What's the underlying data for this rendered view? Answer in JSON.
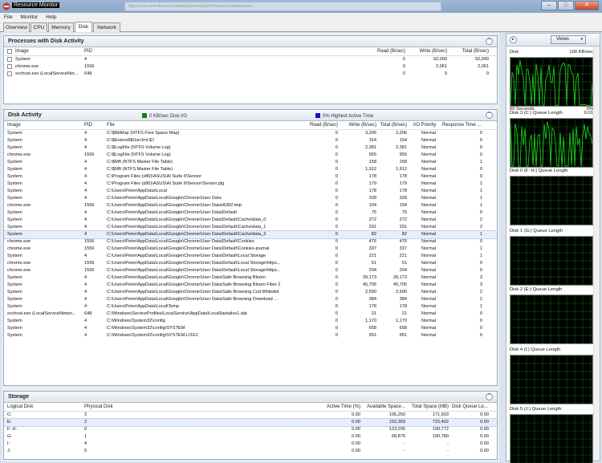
{
  "window": {
    "title": "Resource Monitor",
    "url_text": "http://www.sevenforums.com/attachments/performance-maintenance/...",
    "min": "–",
    "max": "□",
    "close": "✕"
  },
  "menu": [
    "File",
    "Monitor",
    "Help"
  ],
  "tabs": [
    "Overview",
    "CPU",
    "Memory",
    "Disk",
    "Network"
  ],
  "processes": {
    "title": "Processes with Disk Activity",
    "columns": [
      "Image",
      "PID",
      "Read (B/sec)",
      "Write (B/sec)",
      "Total (B/sec)"
    ],
    "rows": [
      [
        "System",
        "4",
        "0",
        "92,000",
        "92,000"
      ],
      [
        "chrome.exe",
        "1556",
        "0",
        "2,061",
        "2,061"
      ],
      [
        "svchost.exe (LocalServiceNet...",
        "648",
        "0",
        "9",
        "9"
      ]
    ]
  },
  "disk_activity": {
    "title": "Disk Activity",
    "legend_io": "0 KB/sec Disk I/O",
    "legend_active": "0% Highest Active Time",
    "io_color": "#1a7a1a",
    "active_color": "#1414c8",
    "columns": [
      "Image",
      "PID",
      "File",
      "Read (B/sec)",
      "Write (B/sec)",
      "Total (B/sec)",
      "I/O Priority",
      "Response Time ..."
    ],
    "rows": [
      [
        "System",
        "4",
        "C:\\$BitMap (NTFS Free Space Map)",
        "0",
        "3,206",
        "3,206",
        "Normal",
        "0"
      ],
      [
        "System",
        "4",
        "C:\\$Extend\\$UsnJrnl:$J",
        "0",
        "154",
        "154",
        "Normal",
        "0"
      ],
      [
        "System",
        "4",
        "C:\\$LogFile (NTFS Volume Log)",
        "0",
        "2,381",
        "2,381",
        "Normal",
        "0"
      ],
      [
        "chrome.exe",
        "1556",
        "C:\\$LogFile (NTFS Volume Log)",
        "0",
        "955",
        "955",
        "Normal",
        "0"
      ],
      [
        "System",
        "4",
        "C:\\$Mft (NTFS Master File Table)",
        "0",
        "158",
        "158",
        "Normal",
        "1"
      ],
      [
        "System",
        "4",
        "C:\\$Mft (NTFS Master File Table)",
        "0",
        "1,912",
        "1,912",
        "Normal",
        "0"
      ],
      [
        "System",
        "4",
        "C:\\Program Files (x86)\\ASUS\\AI Suite II\\Sensor",
        "0",
        "178",
        "178",
        "Normal",
        "0"
      ],
      [
        "System",
        "4",
        "C:\\Program Files (x86)\\ASUS\\AI Suite II\\Sensor\\Sensor.plg",
        "0",
        "179",
        "179",
        "Normal",
        "1"
      ],
      [
        "System",
        "4",
        "C:\\Users\\Peter\\AppData\\Local",
        "0",
        "178",
        "178",
        "Normal",
        "1"
      ],
      [
        "System",
        "4",
        "C:\\Users\\Peter\\AppData\\Local\\Google\\Chrome\\User Data",
        "0",
        "328",
        "328",
        "Normal",
        "1"
      ],
      [
        "chrome.exe",
        "1556",
        "C:\\Users\\Peter\\AppData\\Local\\Google\\Chrome\\User Data\\A392.tmp",
        "0",
        "104",
        "104",
        "Normal",
        "1"
      ],
      [
        "System",
        "4",
        "C:\\Users\\Peter\\AppData\\Local\\Google\\Chrome\\User Data\\Default",
        "0",
        "75",
        "75",
        "Normal",
        "0"
      ],
      [
        "System",
        "4",
        "C:\\Users\\Peter\\AppData\\Local\\Google\\Chrome\\User Data\\Default\\Cache\\data_0",
        "0",
        "272",
        "272",
        "Normal",
        "2"
      ],
      [
        "System",
        "4",
        "C:\\Users\\Peter\\AppData\\Local\\Google\\Chrome\\User Data\\Default\\Cache\\data_1",
        "0",
        "291",
        "291",
        "Normal",
        "2"
      ],
      [
        "System",
        "4",
        "C:\\Users\\Peter\\AppData\\Local\\Google\\Chrome\\User Data\\Default\\Cache\\data_2",
        "0",
        "82",
        "82",
        "Normal",
        "1"
      ],
      [
        "chrome.exe",
        "1556",
        "C:\\Users\\Peter\\AppData\\Local\\Google\\Chrome\\User Data\\Default\\Cookies",
        "0",
        "476",
        "476",
        "Normal",
        "0"
      ],
      [
        "chrome.exe",
        "1556",
        "C:\\Users\\Peter\\AppData\\Local\\Google\\Chrome\\User Data\\Default\\Cookies-journal",
        "0",
        "337",
        "337",
        "Normal",
        "1"
      ],
      [
        "System",
        "4",
        "C:\\Users\\Peter\\AppData\\Local\\Google\\Chrome\\User Data\\Default\\Local Storage",
        "0",
        "221",
        "221",
        "Normal",
        "1"
      ],
      [
        "chrome.exe",
        "1556",
        "C:\\Users\\Peter\\AppData\\Local\\Google\\Chrome\\User Data\\Default\\Local Storage\\https...",
        "0",
        "51",
        "51",
        "Normal",
        "0"
      ],
      [
        "chrome.exe",
        "1556",
        "C:\\Users\\Peter\\AppData\\Local\\Google\\Chrome\\User Data\\Default\\Local Storage\\https...",
        "0",
        "204",
        "204",
        "Normal",
        "0"
      ],
      [
        "System",
        "4",
        "C:\\Users\\Peter\\AppData\\Local\\Google\\Chrome\\User Data\\Safe Browsing Bloom",
        "0",
        "39,173",
        "39,173",
        "Normal",
        "3"
      ],
      [
        "System",
        "4",
        "C:\\Users\\Peter\\AppData\\Local\\Google\\Chrome\\User Data\\Safe Browsing Bloom Filter 2",
        "0",
        "45,705",
        "45,705",
        "Normal",
        "3"
      ],
      [
        "System",
        "4",
        "C:\\Users\\Peter\\AppData\\Local\\Google\\Chrome\\User Data\\Safe Browsing Csd Whitelist",
        "0",
        "2,590",
        "2,590",
        "Normal",
        "2"
      ],
      [
        "System",
        "4",
        "C:\\Users\\Peter\\AppData\\Local\\Google\\Chrome\\User Data\\Safe Browsing Download ...",
        "0",
        "384",
        "384",
        "Normal",
        "2"
      ],
      [
        "System",
        "4",
        "C:\\Users\\Peter\\AppData\\Local\\Temp",
        "0",
        "178",
        "178",
        "Normal",
        "1"
      ],
      [
        "svchost.exe (LocalServiceNetwo...",
        "648",
        "C:\\Windows\\ServiceProfiles\\LocalService\\AppData\\Local\\lastalive1.dat",
        "0",
        "21",
        "21",
        "Normal",
        "0"
      ],
      [
        "System",
        "4",
        "C:\\Windows\\System32\\config",
        "0",
        "1,170",
        "1,170",
        "Normal",
        "0"
      ],
      [
        "System",
        "4",
        "C:\\Windows\\System32\\config\\SYSTEM",
        "0",
        "658",
        "658",
        "Normal",
        "0"
      ],
      [
        "System",
        "4",
        "C:\\Windows\\System32\\config\\SYSTEM.LOG1",
        "0",
        "951",
        "951",
        "Normal",
        "0"
      ]
    ]
  },
  "storage": {
    "title": "Storage",
    "columns": [
      "Logical Disk",
      "Physical Disk",
      "Active Time (%)",
      "Available Space...",
      "Total Space (MB)",
      "Disk Queue Le..."
    ],
    "rows": [
      [
        "C:",
        "3",
        "0.00",
        "105,250",
        "171,603",
        "0.00"
      ],
      [
        "E:",
        "2",
        "0.00",
        "193,303",
        "715,402",
        "0.00"
      ],
      [
        "F: H:",
        "0",
        "0.00",
        "123,295",
        "190,772",
        "0.00"
      ],
      [
        "G:",
        "1",
        "0.00",
        "68,876",
        "190,780",
        "0.00"
      ],
      [
        "I:",
        "4",
        "0.00",
        "-",
        "-",
        "0.00"
      ],
      [
        "J:",
        "5",
        "0.00",
        "-",
        "-",
        "0.00"
      ]
    ]
  },
  "right_panel": {
    "expand": "▸",
    "views_label": "Views",
    "views_arrow": "▾",
    "disk_graph": {
      "label": "Disk",
      "scale": "100 KB/sec",
      "footer_left": "60 Seconds",
      "footer_right": "0%"
    },
    "queue_graphs": [
      {
        "label": "Disk 3 (C:) Queue Length",
        "scale": "0.01"
      },
      {
        "label": "Disk 0 (F: H:) Queue Length",
        "scale": ""
      },
      {
        "label": "Disk 1 (G:) Queue Length",
        "scale": ""
      },
      {
        "label": "Disk 2 (E:) Queue Length",
        "scale": ""
      },
      {
        "label": "Disk 4 (I:) Queue Length",
        "scale": ""
      },
      {
        "label": "Disk 5 (J:) Queue Length",
        "scale": ""
      }
    ],
    "graph_line_color": "#19e019",
    "grid_color": "#0d6b0d"
  },
  "collapse_glyph": "⌃"
}
